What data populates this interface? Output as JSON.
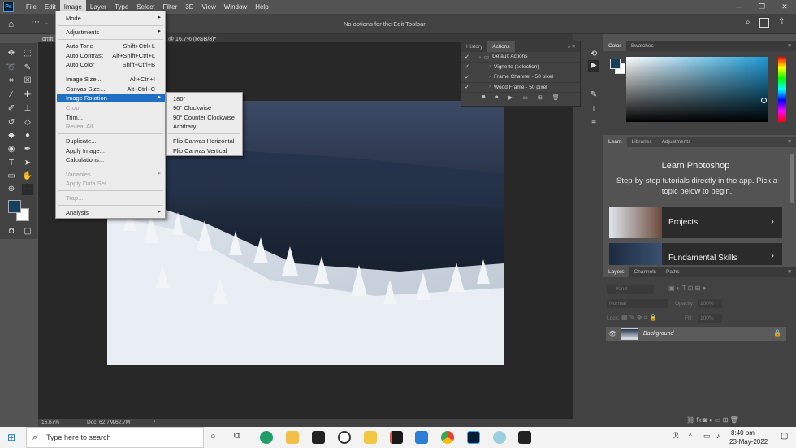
{
  "menubar": {
    "logo": "Ps",
    "items": [
      "File",
      "Edit",
      "Image",
      "Layer",
      "Type",
      "Select",
      "Filter",
      "3D",
      "View",
      "Window",
      "Help"
    ],
    "active": "Image"
  },
  "window_controls": {
    "minimize": "—",
    "restore": "❐",
    "close": "✕"
  },
  "options_bar": {
    "message": "No options for the Edit Toolbar."
  },
  "document_tab": {
    "name_fragment": "dmit",
    "zoom_fragment": "@ 16.7% (RGB/8)*"
  },
  "status": {
    "zoom": "16.67%",
    "doc": "Doc: 62.7M/62.7M"
  },
  "image_menu": {
    "mode": "Mode",
    "adjustments": "Adjustments",
    "auto_tone": "Auto Tone",
    "auto_tone_sc": "Shift+Ctrl+L",
    "auto_contrast": "Auto Contrast",
    "auto_contrast_sc": "Alt+Shift+Ctrl+L",
    "auto_color": "Auto Color",
    "auto_color_sc": "Shift+Ctrl+B",
    "image_size": "Image Size...",
    "image_size_sc": "Alt+Ctrl+I",
    "canvas_size": "Canvas Size...",
    "canvas_size_sc": "Alt+Ctrl+C",
    "image_rotation": "Image Rotation",
    "crop": "Crop",
    "trim": "Trim...",
    "reveal_all": "Reveal All",
    "duplicate": "Duplicate...",
    "apply_image": "Apply Image...",
    "calculations": "Calculations...",
    "variables": "Variables",
    "apply_data_set": "Apply Data Set...",
    "trap": "Trap...",
    "analysis": "Analysis"
  },
  "rotation_submenu": {
    "r180": "180°",
    "cw90": "90° Clockwise",
    "ccw90": "90° Counter Clockwise",
    "arbitrary": "Arbitrary...",
    "flip_h": "Flip Canvas Horizontal",
    "flip_v": "Flip Canvas Vertical"
  },
  "history_panel": {
    "tabs": [
      "History",
      "Actions"
    ],
    "active_tab": "Actions",
    "rows": [
      "Default Actions",
      "Vignette (selection)",
      "Frame Channel - 50 pixel",
      "Wood Frame - 50 pixel"
    ]
  },
  "color_panel": {
    "tabs": [
      "Color",
      "Swatches"
    ],
    "foreground": "#14405e"
  },
  "learn_panel": {
    "tabs": [
      "Learn",
      "Libraries",
      "Adjustments"
    ],
    "title": "Learn Photoshop",
    "subtitle": "Step-by-step tutorials directly in the app. Pick a topic below to begin.",
    "cards": [
      "Projects",
      "Fundamental Skills"
    ]
  },
  "layers_panel": {
    "tabs": [
      "Layers",
      "Channels",
      "Paths"
    ],
    "kind": "Kind",
    "blend": "Normal",
    "opacity_label": "Opacity:",
    "opacity": "100%",
    "lock_label": "Lock:",
    "fill_label": "Fill:",
    "fill": "100%",
    "layer_name": "Background"
  },
  "taskbar": {
    "search_placeholder": "Type here to search",
    "time": "8:40 pm",
    "date": "23-May-2022"
  }
}
